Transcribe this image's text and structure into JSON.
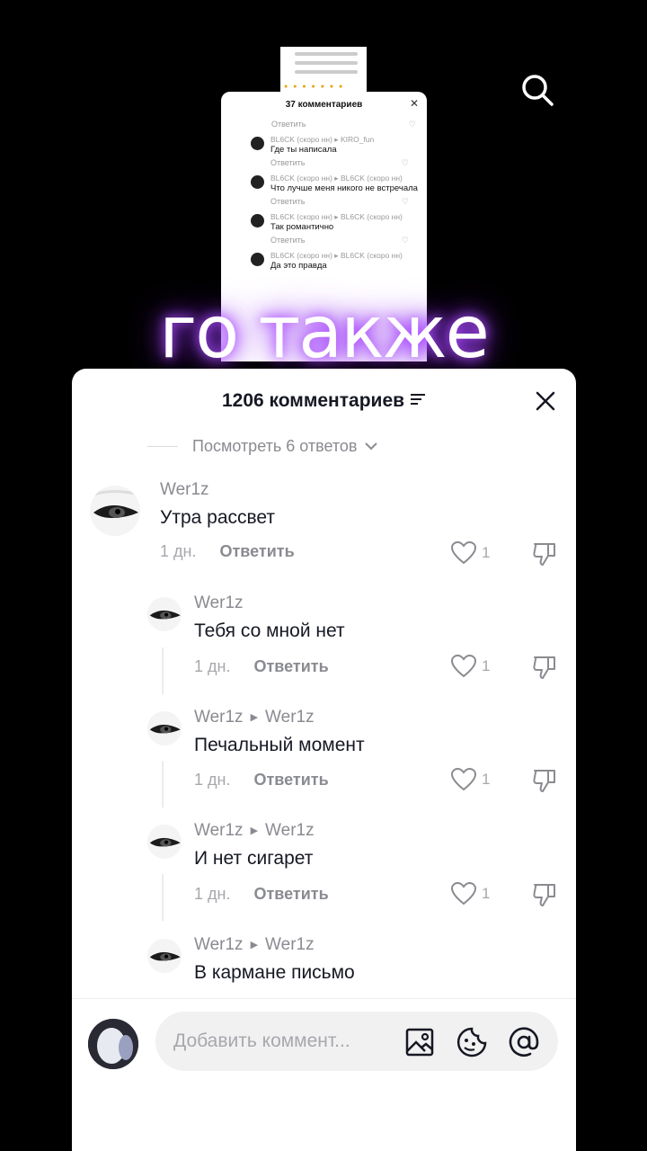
{
  "background_video": {
    "mini_panel_title": "37 комментариев",
    "mini_reply_label": "Ответить",
    "mini_comments": [
      {
        "user": "BL6CK (скоро нн) ▸ KIRO_fun",
        "text": "Где ты написала"
      },
      {
        "user": "BL6CK (скоро нн) ▸ BL6CK (скоро нн)",
        "text": "Что лучше меня никого не встречала"
      },
      {
        "user": "BL6CK (скоро нн) ▸ BL6CK (скоро нн)",
        "text": "Так романтично"
      },
      {
        "user": "BL6CK (скоро нн) ▸ BL6CK (скоро нн)",
        "text": "Да это правда"
      }
    ]
  },
  "caption": "го также",
  "sheet": {
    "title": "1206 комментариев",
    "view_replies": "Посмотреть 6 ответов"
  },
  "comments": [
    {
      "user": "Wer1z",
      "reply_to": "",
      "text": "Утра рассвет",
      "time": "1 дн.",
      "reply": "Ответить",
      "likes": "1"
    },
    {
      "user": "Wer1z",
      "reply_to": "",
      "text": "Тебя со мной нет",
      "time": "1 дн.",
      "reply": "Ответить",
      "likes": "1"
    },
    {
      "user": "Wer1z",
      "reply_to": "Wer1z",
      "text": "Печальный момент",
      "time": "1 дн.",
      "reply": "Ответить",
      "likes": "1"
    },
    {
      "user": "Wer1z",
      "reply_to": "Wer1z",
      "text": "И нет сигарет",
      "time": "1 дн.",
      "reply": "Ответить",
      "likes": "1"
    },
    {
      "user": "Wer1z",
      "reply_to": "Wer1z",
      "text": "В кармане письмо",
      "time": "",
      "reply": "",
      "likes": ""
    }
  ],
  "input": {
    "placeholder": "Добавить коммент..."
  },
  "icons": {
    "search": "search-icon",
    "close": "close-icon",
    "sort": "sort-icon",
    "like": "heart-icon",
    "dislike": "thumbs-down-icon",
    "image": "image-icon",
    "emoji": "emoji-icon",
    "mention": "at-icon"
  }
}
